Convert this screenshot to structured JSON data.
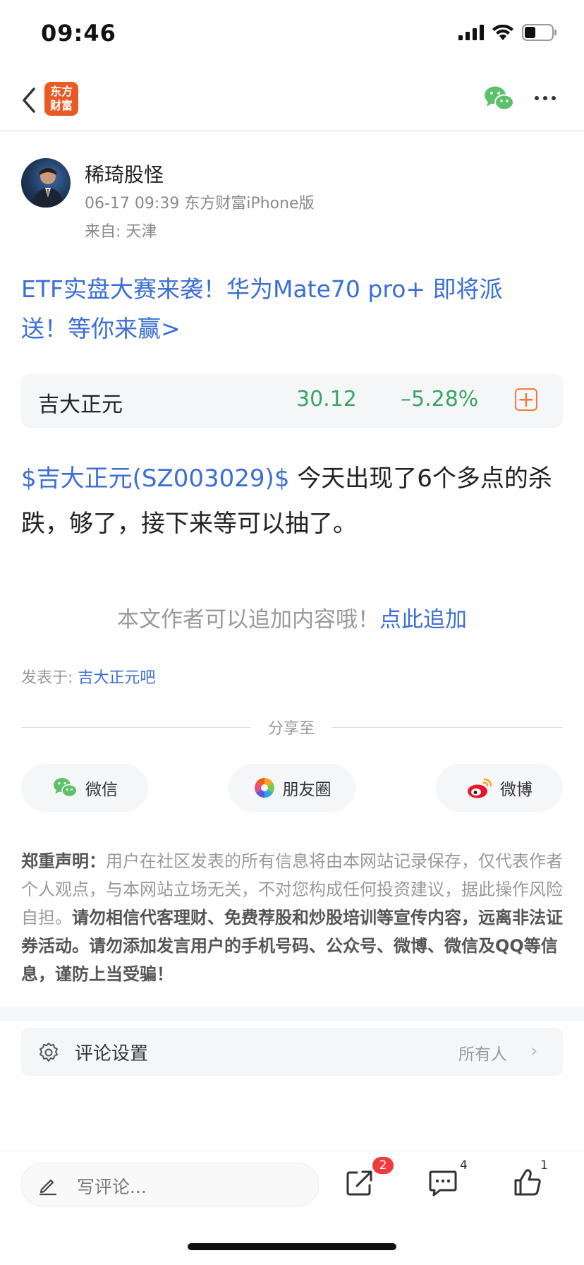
{
  "status_bar": {
    "time": "09:46"
  },
  "nav": {
    "logo_line1": "东方",
    "logo_line2": "财富"
  },
  "author": {
    "name": "稀琦股怪",
    "meta": "06-17 09:39 东方财富iPhone版",
    "from": "来自: 天津"
  },
  "promo": {
    "text": "ETF实盘大赛来袭！华为Mate70 pro+ 即将派送！等你来赢>"
  },
  "stock": {
    "name": "吉大正元",
    "price": "30.12",
    "change": "–5.28%",
    "add_symbol": "+"
  },
  "post": {
    "tag": "$吉大正元(SZ003029)$",
    "body": " 今天出现了6个多点的杀跌，够了，接下来等可以抽了。"
  },
  "append": {
    "text": "本文作者可以追加内容哦！",
    "link": "点此追加"
  },
  "posted_in": {
    "label": "发表于: ",
    "bar": "吉大正元吧"
  },
  "share": {
    "title": "分享至",
    "wechat": "微信",
    "moments": "朋友圈",
    "weibo": "微博"
  },
  "disclaimer": {
    "heading": "郑重声明：",
    "normal": "用户在社区发表的所有信息将由本网站记录保存，仅代表作者个人观点，与本网站立场无关，不对您构成任何投资建议，据此操作风险自担。",
    "bold": "请勿相信代客理财、免费荐股和炒股培训等宣传内容，远离非法证券活动。请勿添加发言用户的手机号码、公众号、微博、微信及QQ等信息，谨防上当受骗！"
  },
  "comment_settings": {
    "label": "评论设置",
    "value": "所有人"
  },
  "bottom_bar": {
    "placeholder": "写评论...",
    "share_badge": "2",
    "comment_count": "4",
    "like_count": "1"
  },
  "colors": {
    "link_blue": "#3b6fd6",
    "stock_green": "#3aa564",
    "brand_orange": "#ea5a24",
    "badge_red": "#f03b3b"
  }
}
